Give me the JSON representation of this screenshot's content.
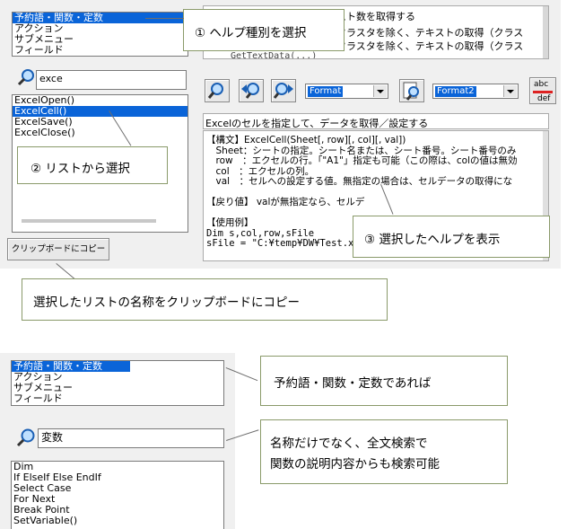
{
  "top": {
    "category_list": [
      "予約語・関数・定数",
      "アクション",
      "サブメニュー",
      "フィールド"
    ],
    "category_selected_index": 0,
    "search_value": "exce",
    "results_list": [
      "ExcelOpen()",
      "ExcelCell()",
      "ExcelSave()",
      "ExcelClose()"
    ],
    "results_selected_index": 1,
    "func_list": [
      "スト数を取得する",
      "クラスタを除く、テキストの取得（クラス",
      "クラスタを除く、テキストの取得（クラス"
    ],
    "func_list_code": "GetTextData(...)",
    "combo1_value": "Format",
    "combo2_value": "Format2",
    "abc_label_top": "abc",
    "abc_label_bottom": "def",
    "description": "Excelのセルを指定して、データを取得／設定する",
    "doc_lines": [
      "【構文】ExcelCell(Sheet[, row][, col][, val])",
      "　Sheet：シートの指定。シート名または、シート番号。シート番号のみ",
      "　row　：エクセルの行。「\"A1\"」指定も可能（この際は、colの値は無効",
      "　col　：エクセルの列。",
      "　val　：セルへの設定する値。無指定の場合は、セルデータの取得にな",
      "",
      "【戻り値】 valが無指定なら、セルデ",
      "",
      "【使用例】",
      "Dim s,col,row,sFile",
      "sFile = \"C:¥temp¥DW¥Test.xlsx\""
    ],
    "clipboard_button": "クリップボードにコピー",
    "callout_help_type": "① ヘルプ種別を選択",
    "callout_list_select": "② リストから選択",
    "callout_show_help": "③ 選択したヘルプを表示",
    "callout_clipboard": "選択したリストの名称をクリップボードにコピー"
  },
  "bottom": {
    "category_list": [
      "予約語・関数・定数",
      "アクション",
      "サブメニュー",
      "フィールド"
    ],
    "category_selected_index": 0,
    "search_value": "変数",
    "results_list": [
      "Dim",
      "If ElseIf Else EndIf",
      "Select Case",
      "For Next",
      "Break Point",
      "SetVariable()"
    ],
    "callout_category": "予約語・関数・定数であれば",
    "callout_fulltext_1": "名称だけでなく、全文検索で",
    "callout_fulltext_2": "関数の説明内容からも検索可能"
  },
  "colors": {
    "selection": "#0a64d8",
    "callout_border": "#8a9a6a",
    "panel": "#f0f0f0"
  },
  "icons": [
    "search-icon",
    "find-icon",
    "find-prev-icon",
    "find-next-icon",
    "find-in-doc-icon",
    "abc-def-icon"
  ]
}
